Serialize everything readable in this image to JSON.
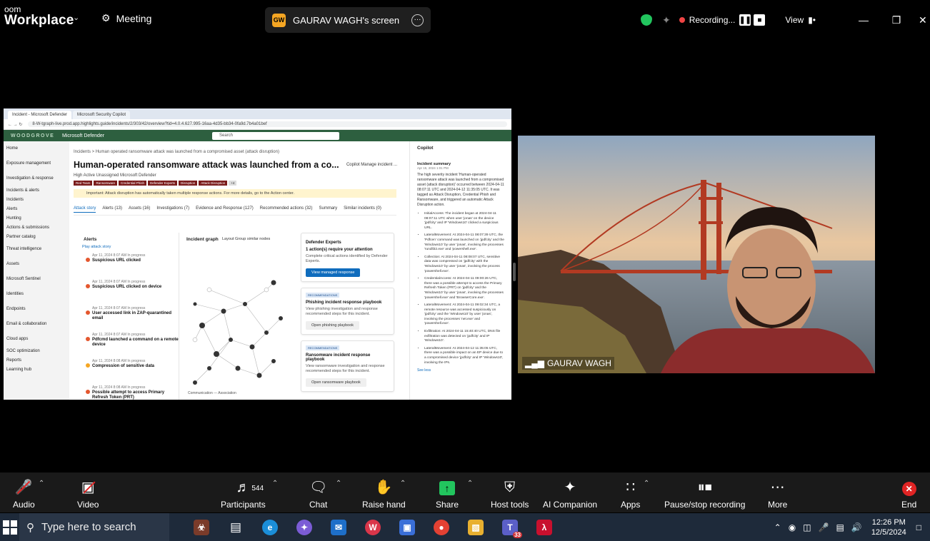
{
  "window": {
    "brand_line1": "oom",
    "brand_line2": "Workplace",
    "meeting_label": "Meeting",
    "share_label": "GAURAV WAGH's screen",
    "recording_label": "Recording...",
    "view_label": "View"
  },
  "shared_screen": {
    "browser_tabs": [
      "Incident - Microsoft Defender",
      "Microsoft Security Copilot"
    ],
    "url": "8-W-tgraph-live.prod.app.highlights.guide/incidents/2/303/42/overview?tid=4.0.4.627.995-16aa-4d35-bb34-0fa9d.7b4a01bef",
    "org_logo": "WOODGROVE",
    "product_name": "Microsoft Defender",
    "search_placeholder": "Search",
    "nav_items": [
      "Home",
      "Exposure management",
      "Investigation & response",
      "Incidents & alerts",
      "Incidents",
      "Alerts",
      "Hunting",
      "Actions & submissions",
      "Partner catalog",
      "Threat intelligence",
      "Assets",
      "Microsoft Sentinel",
      "Identities",
      "Endpoints",
      "Email & collaboration",
      "Cloud apps",
      "SOC optimization",
      "Reports",
      "Learning hub"
    ],
    "breadcrumb": "Incidents  >  Human operated ransomware attack was launched from a compromised asset (attack disruption)",
    "incident_title": "Human-operated ransomware attack was launched from a co...",
    "title_actions": "Copilot   Manage incident   ...",
    "meta": "High   Active   Unassigned   Microsoft Defender",
    "tags": [
      "Red Team",
      "Ransomware",
      "Credential Phish",
      "Defender Experts",
      "Disruption",
      "Attack Disruption",
      "+4"
    ],
    "banner": "Important: Attack disruption has automatically taken multiple response actions. For more details, go to the Action center.",
    "tabs": [
      "Attack story",
      "Alerts (13)",
      "Assets (16)",
      "Investigations (7)",
      "Evidence and Response (127)",
      "Recommended actions (32)",
      "Summary",
      "Similar incidents (0)"
    ],
    "alerts_heading": "Alerts",
    "alerts_play": "Play attack story",
    "alerts": [
      {
        "time": "Apr 11, 2024 8:07 AM  In progress",
        "name": "Suspicious URL clicked",
        "color": "#e4572e"
      },
      {
        "time": "Apr 11, 2024 8:07 AM  In progress",
        "name": "Suspicious URL clicked on device",
        "color": "#e4572e"
      },
      {
        "time": "Apr 11, 2024 8:07 AM  In progress",
        "name": "User accessed link in ZAP-quarantined email",
        "color": "#e4572e"
      },
      {
        "time": "Apr 11, 2024 8:07 AM  In progress",
        "name": "Pdfcmd launched a command on a remote device",
        "color": "#e4572e"
      },
      {
        "time": "Apr 11, 2024 8:08 AM  In progress",
        "name": "Compression of sensitive data",
        "color": "#f5a623"
      },
      {
        "time": "Apr 11, 2024 8:08 AM  In progress",
        "name": "Possible attempt to access Primary Refresh Token (PRT)",
        "color": "#e4572e"
      }
    ],
    "graph_heading": "Incident graph",
    "graph_controls": "Layout   Group similar nodes",
    "graph_legend": "Communication  ---  Association",
    "cards": [
      {
        "chip": "",
        "heading": "Defender Experts",
        "subheading": "1 action(s) require your attention",
        "desc": "Complete critical actions identified by Defender Experts.",
        "button": "View managed response",
        "primary": true
      },
      {
        "chip": "RECOMMENDATIONS",
        "heading": "Phishing incident response playbook",
        "subheading": "",
        "desc": "View phishing investigation and response recommended steps for this incident.",
        "button": "Open phishing playbook",
        "primary": false
      },
      {
        "chip": "RECOMMENDATIONS",
        "heading": "Ransomware incident response playbook",
        "subheading": "",
        "desc": "View ransomware investigation and response recommended steps for this incident.",
        "button": "Open ransomware playbook",
        "primary": false
      }
    ],
    "copilot": {
      "heading": "Copilot",
      "summary_heading": "Incident summary",
      "summary_time": "Apr 15, 2024 1:01 PM",
      "summary": "The high severity incident 'Human-operated ransomware attack was launched from a compromised asset (attack disruption)' occurred between 2024-04-11 08:07:11 UTC and 2024-04-12 11:35:05 UTC. It was tagged as Attack Disruption, Credential Phish and Ransomware, and triggered an automatic Attack Disruption action.",
      "bullets": [
        "InitialAccess: The incident began at 2024-04-11 08:07:11 UTC when user 'jonas' on the device 'jpdfcity' and IP 'Windows10' clicked a suspicious URL.",
        "LateralMovement: At 2024-04-11 08:07:39 UTC, the 'Pdfcen' command was launched on 'jpdfcity' and the 'Windows10' by user 'jonas', involving the processes 'rundll32.exe' and 'powershell.exe'.",
        "Collection: At 2024-04-11 08:08:07 UTC, sensitive data was compressed on 'jpdfcity' with the 'Windows10' by user 'jonas', involving the process 'powershell.exe'.",
        "CredentialAccess: At 2024-04-11 09:00:26 UTC, there was a possible attempt to access the Primary Refresh Token (PRT) on 'jpdfcity' and the 'Windows10' by user 'jonas', involving the processes 'powershell.exe' and 'BrowserCore.exe'.",
        "LateralMovement: At 2024-04-11 09:02:34 UTC, a remote resource was accessed suspiciously on 'jpdfcity' and the 'Windows10' by user 'jonas', involving the processes 'net.exe' and 'powershell.exe'.",
        "Exfiltration: At 2024-04-11 15:40:40 UTC, DNS file exfiltration was detected on 'jpdfcity' and IP 'Windows10'.",
        "LateralMovement: At 2024-04-12 11:35:05 UTC, there was a possible impact on an EP device due to a compromised device 'jpdfcity' and IP 'Windows10', involving the IPs."
      ],
      "see_less": "See less"
    }
  },
  "video_tile": {
    "participant_name": "GAURAV WAGH"
  },
  "controls": {
    "audio": "Audio",
    "video": "Video",
    "participants": "Participants",
    "participants_count": "544",
    "chat": "Chat",
    "raise_hand": "Raise hand",
    "share": "Share",
    "host_tools": "Host tools",
    "ai_companion": "AI Companion",
    "apps": "Apps",
    "pause_stop": "Pause/stop recording",
    "more": "More",
    "end": "End"
  },
  "taskbar": {
    "search_placeholder": "Type here to search",
    "time": "12:26 PM",
    "date": "12/5/2024",
    "teams_badge": "33"
  },
  "colors": {
    "recording_dot": "#ef4444",
    "share_green": "#22c55e",
    "end_red": "#e02424",
    "defender_green": "#2d5f3f",
    "taskbar_bg": "#1e2a3a"
  }
}
